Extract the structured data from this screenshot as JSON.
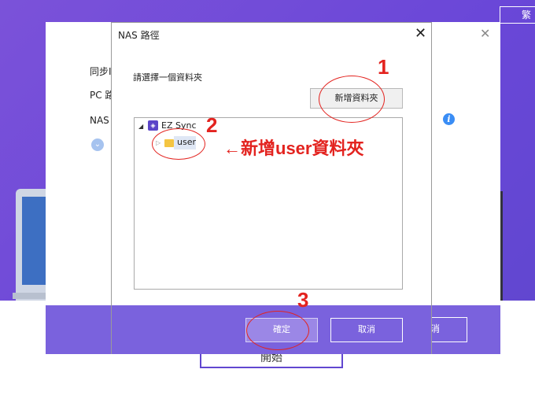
{
  "app": {
    "language_button": "繁",
    "start_button": "開始",
    "setup_labels": [
      "同步I",
      "PC 路",
      "NAS I"
    ],
    "cancel_label": "消",
    "info_icon": "info-icon",
    "expand_icon": "chevron-down-icon"
  },
  "dialog": {
    "title": "NAS 路徑",
    "close": "✕",
    "prompt": "請選擇一個資料夾",
    "new_folder_button": "新增資料夾",
    "tree": {
      "root": "EZ Sync",
      "child": "user"
    },
    "ok_button": "確定",
    "cancel_button": "取消"
  },
  "annotations": {
    "step1": "1",
    "step2": "2",
    "step3": "3",
    "callout": "←新增user資料夾"
  },
  "colors": {
    "accent": "#7a62dd",
    "annotation": "#e3231f"
  }
}
